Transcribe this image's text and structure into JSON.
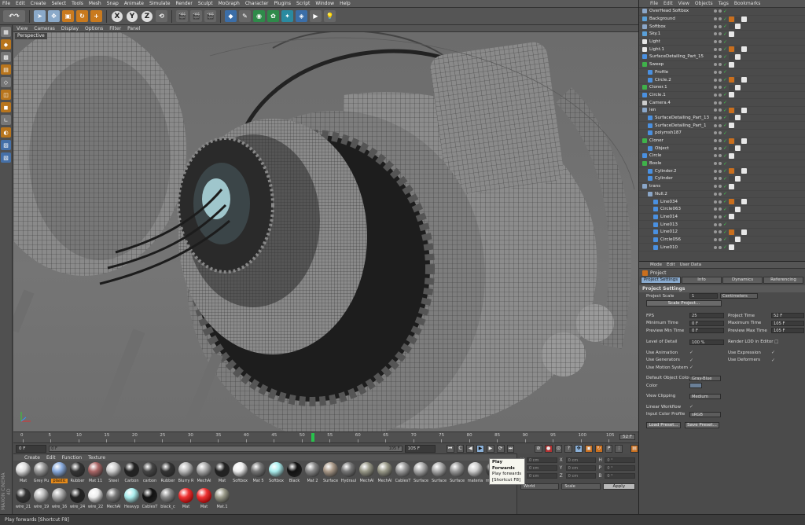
{
  "menubar": [
    "File",
    "Edit",
    "Create",
    "Select",
    "Tools",
    "Mesh",
    "Snap",
    "Animate",
    "Simulate",
    "Render",
    "Sculpt",
    "MoGraph",
    "Character",
    "Plugins",
    "Script",
    "Window",
    "Help"
  ],
  "axes": [
    "X",
    "Y",
    "Z"
  ],
  "viewport": {
    "menu": [
      "View",
      "Cameras",
      "Display",
      "Options",
      "Filter",
      "Panel"
    ],
    "label": "Perspective"
  },
  "timeline": {
    "ticks": [
      "0",
      "5",
      "10",
      "15",
      "20",
      "25",
      "30",
      "35",
      "40",
      "45",
      "50",
      "55",
      "60",
      "65",
      "70",
      "75",
      "80",
      "85",
      "90",
      "95",
      "100",
      "105"
    ],
    "current_frame": 52,
    "end_label": "52 F"
  },
  "transport": {
    "start": "0 F",
    "range_start": "0 F",
    "range_end": "105 F",
    "end": "105 F"
  },
  "tooltip": {
    "title": "Play Forwards",
    "desc": "Play forwards",
    "shortcut": "[Shortcut F8]"
  },
  "materials": {
    "menu": [
      "Create",
      "Edit",
      "Function",
      "Texture"
    ],
    "row1": [
      "Mat",
      "Grey Pu",
      "plastic",
      "Rubber",
      "Mat 11",
      "Steel",
      "Carbon",
      "carbon",
      "Rubber",
      "Blurry R",
      "MechAl",
      "Mat",
      "Softbox",
      "Mat 5",
      "Softbox",
      "Black",
      "Mat 2",
      "Surface",
      "Hydraul",
      "MechAl",
      "MechAl",
      "CablesT",
      "Surface",
      "Surface",
      "Surface",
      "materia"
    ],
    "row2": [
      "materia",
      "wire_21",
      "wire_19",
      "wire_16",
      "wire_24",
      "wire_22",
      "MechAl",
      "Heavyp",
      "CablesT",
      "black_c",
      "Mat",
      "Mat",
      "Mat.1"
    ],
    "highlight_index": 2
  },
  "coords": {
    "rows": [
      {
        "a": "X",
        "av": "0 cm",
        "b": "X",
        "bv": "0 cm",
        "c": "H",
        "cv": "0 °"
      },
      {
        "a": "Y",
        "av": "0 cm",
        "b": "Y",
        "bv": "0 cm",
        "c": "P",
        "cv": "0 °"
      },
      {
        "a": "Z",
        "av": "0 cm",
        "b": "Z",
        "bv": "0 cm",
        "c": "B",
        "cv": "0 °"
      }
    ],
    "mode1": "World",
    "mode2": "Scale",
    "apply": "Apply"
  },
  "status": "Play forwards [Shortcut F8]",
  "logo": "MAXON CINEMA 4D",
  "object_manager": {
    "menu": [
      "File",
      "Edit",
      "View",
      "Objects",
      "Tags",
      "Bookmarks"
    ],
    "items": [
      {
        "name": "OverHead Softbox",
        "indent": 0,
        "color": "#8aa6c8"
      },
      {
        "name": "Background",
        "indent": 0,
        "color": "#5aa0d8"
      },
      {
        "name": "Softbox",
        "indent": 0,
        "color": "#8aa6c8"
      },
      {
        "name": "Sky.1",
        "indent": 0,
        "color": "#5aa0d8"
      },
      {
        "name": "Light",
        "indent": 0,
        "color": "#e8e8e8"
      },
      {
        "name": "Light.1",
        "indent": 0,
        "color": "#e8e8e8"
      },
      {
        "name": "SurfaceDetailing_Part_15",
        "indent": 0,
        "color": "#4a90e0"
      },
      {
        "name": "Sweep",
        "indent": 0,
        "color": "#3fb24a"
      },
      {
        "name": "Profile",
        "indent": 1,
        "color": "#4a90e0"
      },
      {
        "name": "Circle.2",
        "indent": 1,
        "color": "#4a90e0"
      },
      {
        "name": "Cloner.1",
        "indent": 0,
        "color": "#3fb24a"
      },
      {
        "name": "Circle.1",
        "indent": 0,
        "color": "#4a90e0"
      },
      {
        "name": "Camera.4",
        "indent": 0,
        "color": "#ccc"
      },
      {
        "name": "len",
        "indent": 0,
        "color": "#8aa6c8"
      },
      {
        "name": "SurfaceDetailing_Part_13",
        "indent": 1,
        "color": "#4a90e0"
      },
      {
        "name": "SurfaceDetailing_Part_1",
        "indent": 1,
        "color": "#4a90e0"
      },
      {
        "name": "polymsh187",
        "indent": 1,
        "color": "#4a90e0"
      },
      {
        "name": "Cloner",
        "indent": 0,
        "color": "#3fb24a"
      },
      {
        "name": "Object",
        "indent": 1,
        "color": "#4a90e0"
      },
      {
        "name": "Circle",
        "indent": 0,
        "color": "#4a90e0"
      },
      {
        "name": "Boole",
        "indent": 0,
        "color": "#3fb24a"
      },
      {
        "name": "Cylinder.2",
        "indent": 1,
        "color": "#4a90e0"
      },
      {
        "name": "Cylinder",
        "indent": 1,
        "color": "#4a90e0"
      },
      {
        "name": "trans",
        "indent": 0,
        "color": "#8aa6c8"
      },
      {
        "name": "Null.2",
        "indent": 1,
        "color": "#8aa6c8"
      },
      {
        "name": "Line034",
        "indent": 2,
        "color": "#4a90e0"
      },
      {
        "name": "Circle063",
        "indent": 2,
        "color": "#4a90e0"
      },
      {
        "name": "Line014",
        "indent": 2,
        "color": "#4a90e0"
      },
      {
        "name": "Line013",
        "indent": 2,
        "color": "#4a90e0"
      },
      {
        "name": "Line012",
        "indent": 2,
        "color": "#4a90e0"
      },
      {
        "name": "Circle056",
        "indent": 2,
        "color": "#4a90e0"
      },
      {
        "name": "Line010",
        "indent": 2,
        "color": "#4a90e0"
      }
    ]
  },
  "attributes": {
    "menu": [
      "Mode",
      "Edit",
      "User Data"
    ],
    "title": "Project",
    "tabs": [
      "Project Settings",
      "Info",
      "Dynamics",
      "Referencing"
    ],
    "section": "Project Settings",
    "project_scale_label": "Project Scale",
    "project_scale_value": "1",
    "project_scale_unit": "Centimeters",
    "scale_project_btn": "Scale Project...",
    "fps_label": "FPS",
    "fps_value": "25",
    "project_time_label": "Project Time",
    "project_time_value": "52 F",
    "min_time_label": "Minimum Time",
    "min_time_value": "0 F",
    "max_time_label": "Maximum Time",
    "max_time_value": "105 F",
    "prev_min_label": "Preview Min Time",
    "prev_min_value": "0 F",
    "prev_max_label": "Preview Max Time",
    "prev_max_value": "105 F",
    "lod_label": "Level of Detail",
    "lod_value": "100 %",
    "render_lod_label": "Render LOD in Editor",
    "use_animation": "Use Animation",
    "use_expression": "Use Expression",
    "use_generators": "Use Generators",
    "use_deformers": "Use Deformers",
    "use_motion": "Use Motion System",
    "default_color_label": "Default Object Color",
    "default_color_value": "Gray-Blue",
    "color_label": "Color",
    "view_clipping_label": "View Clipping",
    "view_clipping_value": "Medium",
    "linear_workflow_label": "Linear Workflow",
    "input_color_label": "Input Color Profile",
    "input_color_value": "sRGB",
    "load_preset": "Load Preset...",
    "save_preset": "Save Preset..."
  }
}
